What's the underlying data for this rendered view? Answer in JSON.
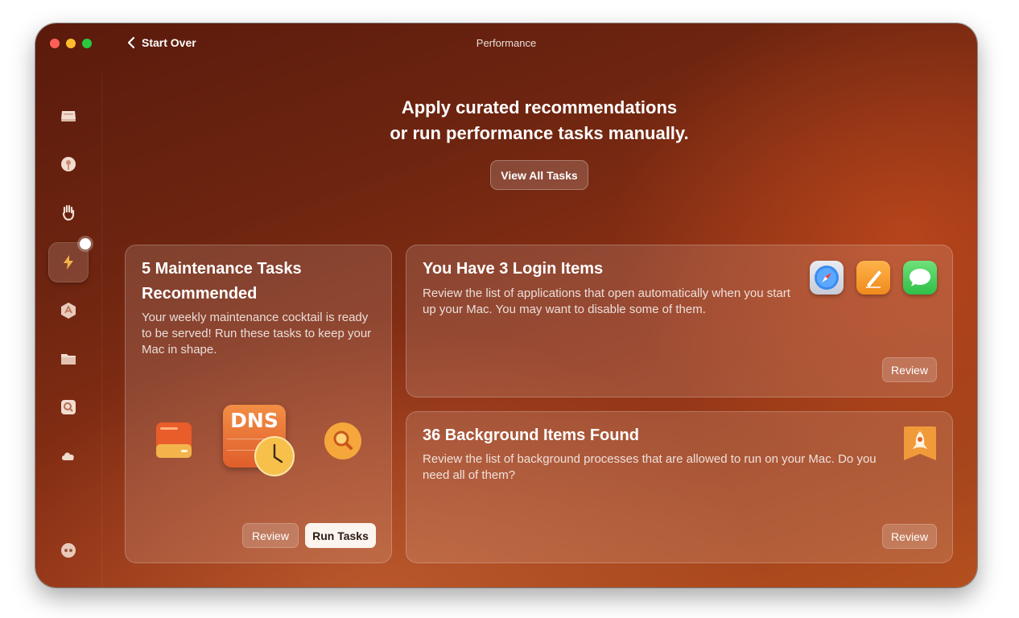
{
  "window": {
    "title": "Performance"
  },
  "nav": {
    "back_label": "Start Over"
  },
  "sidebar": {
    "items": [
      {
        "name": "cleanup",
        "icon": "disk-icon"
      },
      {
        "name": "protection",
        "icon": "shield-icon"
      },
      {
        "name": "privacy",
        "icon": "hand-icon"
      },
      {
        "name": "performance",
        "icon": "lightning-icon",
        "active": true
      },
      {
        "name": "applications",
        "icon": "apps-icon"
      },
      {
        "name": "my-clutter",
        "icon": "folder-icon"
      },
      {
        "name": "space-lens",
        "icon": "magnifier-icon"
      },
      {
        "name": "cloud",
        "icon": "cloud-icon"
      }
    ],
    "footer_icon": "assistant-icon"
  },
  "main": {
    "headline_line1": "Apply curated recommendations",
    "headline_line2": "or run performance tasks manually.",
    "view_all_label": "View All Tasks"
  },
  "cards": {
    "maintenance": {
      "title_line1": "5 Maintenance Tasks",
      "title_line2": "Recommended",
      "description": "Your weekly maintenance cocktail is ready to be served! Run these tasks to keep your Mac in shape.",
      "dns_label": "DNS",
      "review_label": "Review",
      "run_label": "Run Tasks"
    },
    "login_items": {
      "title": "You Have 3 Login Items",
      "description": "Review the list of applications that open automatically when you start up your Mac. You may want to disable some of them.",
      "review_label": "Review",
      "apps": [
        "safari-icon",
        "pages-icon",
        "messages-icon"
      ]
    },
    "background_items": {
      "title": "36 Background Items Found",
      "description": "Review the list of background processes that are allowed to run on your Mac. Do you need all of them?",
      "review_label": "Review"
    }
  },
  "colors": {
    "window_dark": "#5a1a0c",
    "window_light": "#b4501f",
    "accent_orange": "#f0a33c",
    "primary_button_bg": "#fbf4ef"
  }
}
